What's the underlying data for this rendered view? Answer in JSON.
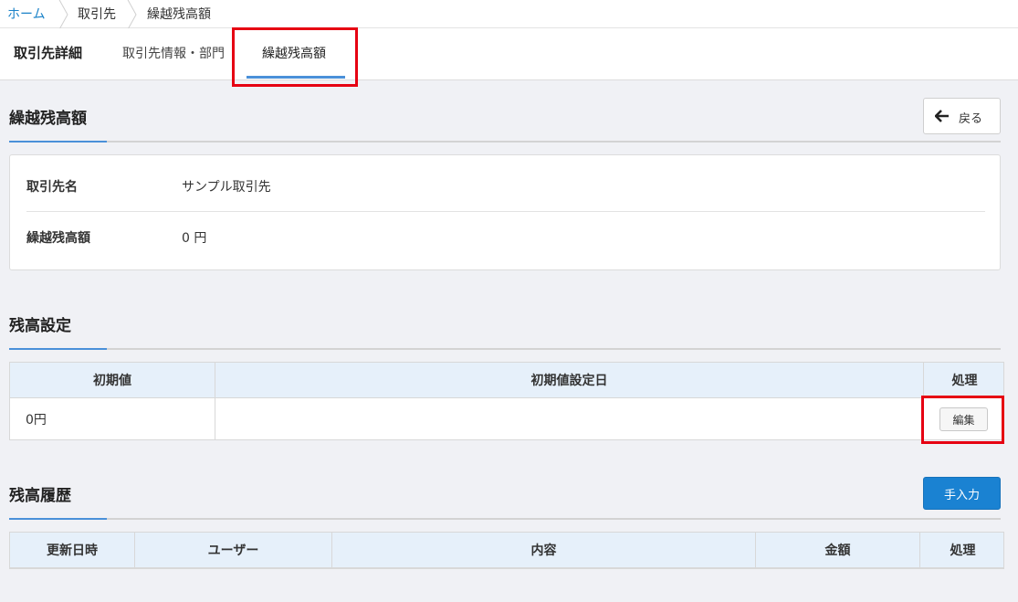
{
  "breadcrumb": {
    "home": "ホーム",
    "clients": "取引先",
    "current": "繰越残高額"
  },
  "subnav": {
    "title": "取引先詳細",
    "tabs": [
      {
        "label": "取引先情報・部門"
      },
      {
        "label": "繰越残高額"
      }
    ]
  },
  "carryover": {
    "title": "繰越残高額",
    "back_label": "戻る",
    "rows": [
      {
        "label": "取引先名",
        "value": "サンプル取引先"
      },
      {
        "label": "繰越残高額",
        "value": "0 円"
      }
    ]
  },
  "balance_setting": {
    "title": "残高設定",
    "headers": [
      "初期値",
      "初期値設定日",
      "処理"
    ],
    "row": {
      "initial_value": "0円",
      "date": "",
      "edit_label": "編集"
    }
  },
  "balance_history": {
    "title": "残高履歴",
    "manual_label": "手入力",
    "headers": [
      "更新日時",
      "ユーザー",
      "内容",
      "金額",
      "処理"
    ]
  },
  "colors": {
    "accent": "#4a90d9",
    "primary_button": "#1a82d2",
    "highlight": "#e60012"
  },
  "icons": {
    "back": "arrow-left-icon",
    "separator": "chevron-right-icon"
  }
}
